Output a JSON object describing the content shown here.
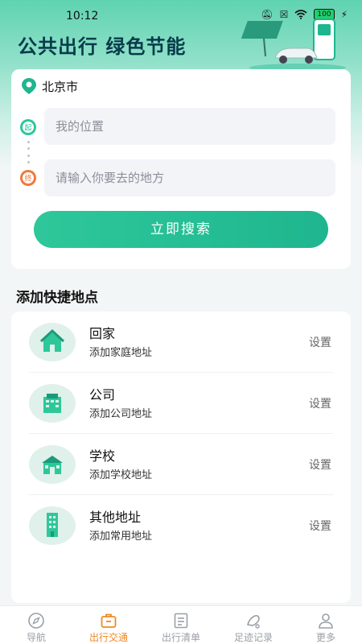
{
  "status_bar": {
    "time": "10:12",
    "battery": "100"
  },
  "hero": {
    "title": "公共出行 绿色节能"
  },
  "search": {
    "city": "北京市",
    "start_marker": "起",
    "end_marker": "终",
    "start_placeholder": "我的位置",
    "end_placeholder": "请输入你要去的地方",
    "button_label": "立即搜索"
  },
  "quick_places": {
    "section_title": "添加快捷地点",
    "items": [
      {
        "title": "回家",
        "subtitle": "添加家庭地址",
        "action": "设置"
      },
      {
        "title": "公司",
        "subtitle": "添加公司地址",
        "action": "设置"
      },
      {
        "title": "学校",
        "subtitle": "添加学校地址",
        "action": "设置"
      },
      {
        "title": "其他地址",
        "subtitle": "添加常用地址",
        "action": "设置"
      }
    ]
  },
  "tabbar": {
    "items": [
      {
        "label": "导航",
        "icon": "compass-icon",
        "active": false
      },
      {
        "label": "出行交通",
        "icon": "bag-icon",
        "active": true
      },
      {
        "label": "出行清单",
        "icon": "list-icon",
        "active": false
      },
      {
        "label": "足迹记录",
        "icon": "footprint-icon",
        "active": false
      },
      {
        "label": "更多",
        "icon": "person-icon",
        "active": false
      }
    ]
  },
  "colors": {
    "accent": "#1fb68f",
    "active_tab": "#f08a24",
    "title": "#083b4a"
  }
}
